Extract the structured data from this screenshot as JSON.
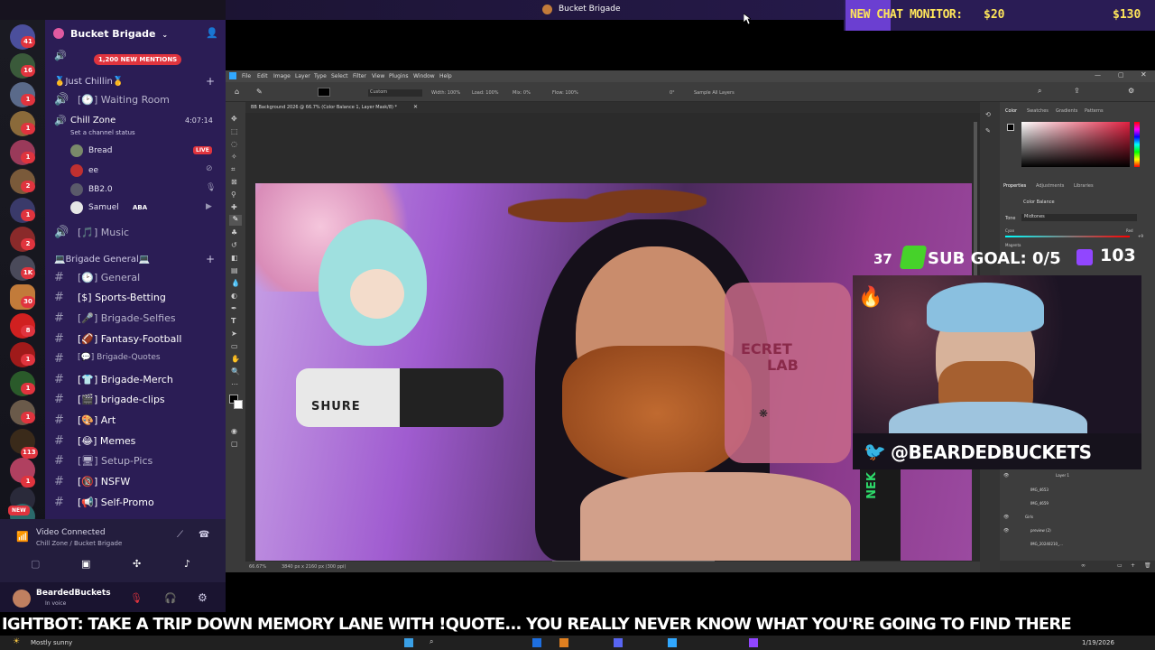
{
  "window": {
    "title": "Bucket Brigade"
  },
  "overlay": {
    "chat_monitor": "NEW CHAT MONITOR:",
    "amount_current": "$20",
    "amount_goal": "$130",
    "sub_count_left": "37",
    "sub_goal": "SUB GOAL: 0/5",
    "sub_count_right": "103",
    "twitter_handle": "@BEARDEDBUCKETS",
    "ticker_text": "IGHTBOT: TAKE A TRIP DOWN MEMORY LANE WITH !QUOTE... YOU REALLY NEVER KNOW WHAT YOU'RE GOING TO FIND THERE"
  },
  "discord": {
    "server_name": "Bucket Brigade",
    "mentions_badge": "1,200 NEW MENTIONS",
    "categories": [
      {
        "label": "🥇Just Chillin🥇"
      },
      {
        "label": "💻Brigade General💻"
      }
    ],
    "voice_channels": [
      {
        "label": "[🕑] Waiting Room"
      },
      {
        "label": "Chill Zone",
        "timer": "4:07:14",
        "status": "Set a channel status"
      },
      {
        "label": "[🎵] Music"
      }
    ],
    "voice_users": [
      {
        "name": "Bread",
        "badge": "LIVE"
      },
      {
        "name": "ee"
      },
      {
        "name": "BB2.0"
      },
      {
        "name": "Samuel",
        "tag": "ABA"
      }
    ],
    "text_channels": [
      {
        "label": "[🕑] General"
      },
      {
        "label": "[$] Sports-Betting"
      },
      {
        "label": "[🎤] Brigade-Selfies"
      },
      {
        "label": "[🏈] Fantasy-Football"
      },
      {
        "label": "[💬] Brigade-Quotes"
      },
      {
        "label": "[👕] Brigade-Merch"
      },
      {
        "label": "[🎬] brigade-clips"
      },
      {
        "label": "[🎨] Art"
      },
      {
        "label": "[😂] Memes"
      },
      {
        "label": "[🖥] Setup-Pics"
      },
      {
        "label": "[🔞] NSFW"
      },
      {
        "label": "[📢] Self-Promo"
      }
    ],
    "server_badges": [
      "41",
      "16",
      "1",
      "1",
      "1",
      "2",
      "1",
      "2",
      "1K",
      "30",
      "8",
      "1",
      "1",
      "1",
      "113",
      "1"
    ],
    "new_label": "NEW",
    "voice_connected": "Video Connected",
    "voice_location": "Chill Zone / Bucket Brigade",
    "username": "BeardedBuckets",
    "user_status": "In voice"
  },
  "photoshop": {
    "menu": [
      "File",
      "Edit",
      "Image",
      "Layer",
      "Type",
      "Select",
      "Filter",
      "View",
      "Plugins",
      "Window",
      "Help"
    ],
    "doc_tab": "BB Background 2026 @ 66.7% (Color Balance 1, Layer Mask/8) *",
    "zoom": "66.67%",
    "doc_size": "3840 px x 2160 px (300 ppi)",
    "options": {
      "preset": "Custom",
      "width": "Width: 100%",
      "load": "Load: 100%",
      "mix": "Mix: 0%",
      "flow": "Flow: 100%",
      "angle": "0°",
      "sample": "Sample All Layers"
    },
    "panels": {
      "tabs": [
        "Color",
        "Swatches",
        "Gradients",
        "Patterns"
      ],
      "props_tabs": [
        "Properties",
        "Adjustments",
        "Libraries"
      ],
      "adjustment": "Color Balance",
      "tone_label": "Tone",
      "tone_value": "Midtones",
      "cyan": "Cyan",
      "red": "Red",
      "magenta": "Magenta",
      "val1": "+9",
      "layers": [
        "Layer 1",
        "IMG_4653",
        "IMG_4659",
        "Girls",
        "preview (2)",
        "IMG_20240210_..."
      ]
    }
  },
  "photo_text": {
    "brand": "SHURE",
    "secret1": "ECRET",
    "secret2": "LAB",
    "side": "NEK"
  },
  "taskbar": {
    "weather": "Mostly sunny",
    "date": "1/19/2026"
  },
  "colors": {
    "discord_bg": "#2b1d55",
    "live_red": "#e0343e",
    "ps_bg": "#393939",
    "chat_accent": "#6b3fd1"
  }
}
